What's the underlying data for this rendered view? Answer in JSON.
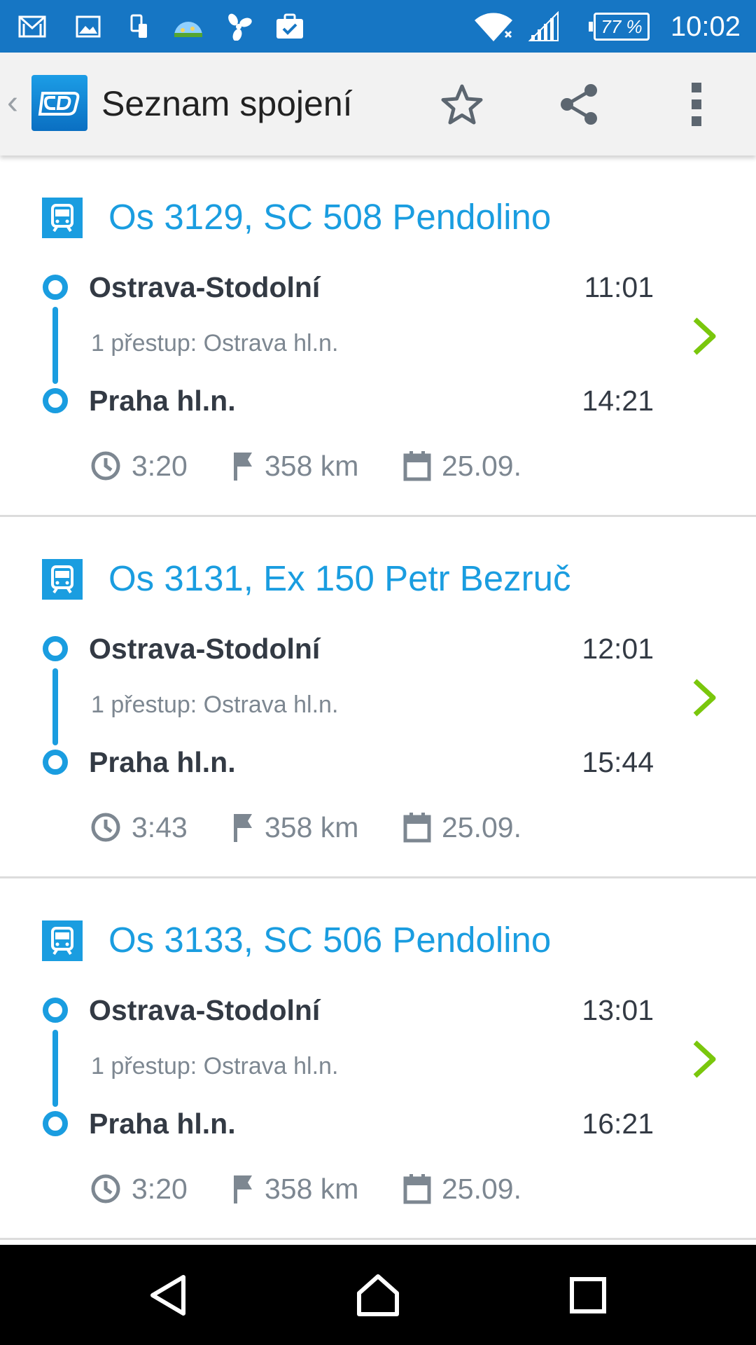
{
  "status_bar": {
    "time": "10:02",
    "battery": "77 %",
    "icons": [
      "gmail-icon",
      "gallery-icon",
      "phone-transfer-icon",
      "weather-icon",
      "fan-icon",
      "work-briefcase-icon",
      "wifi-icon",
      "cellular-signal-icon",
      "battery-icon"
    ]
  },
  "app_bar": {
    "title": "Seznam spojení",
    "logo": "cd-logo",
    "actions": [
      "star-icon",
      "share-icon",
      "overflow-menu-icon"
    ]
  },
  "colors": {
    "status_bar": "#1676c4",
    "accent": "#1a9de0",
    "chevron": "#7ac70c",
    "text_dark": "#333a44",
    "text_muted": "#7d8791"
  },
  "connections": [
    {
      "title": "Os 3129, SC 508 Pendolino",
      "from_station": "Ostrava-Stodolní",
      "from_time": "11:01",
      "transfer": "1 přestup: Ostrava hl.n.",
      "to_station": "Praha hl.n.",
      "to_time": "14:21",
      "duration": "3:20",
      "distance": "358 km",
      "date": "25.09."
    },
    {
      "title": "Os 3131, Ex 150 Petr Bezruč",
      "from_station": "Ostrava-Stodolní",
      "from_time": "12:01",
      "transfer": "1 přestup: Ostrava hl.n.",
      "to_station": "Praha hl.n.",
      "to_time": "15:44",
      "duration": "3:43",
      "distance": "358 km",
      "date": "25.09."
    },
    {
      "title": "Os 3133, SC 506 Pendolino",
      "from_station": "Ostrava-Stodolní",
      "from_time": "13:01",
      "transfer": "1 přestup: Ostrava hl.n.",
      "to_station": "Praha hl.n.",
      "to_time": "16:21",
      "duration": "3:20",
      "distance": "358 km",
      "date": "25.09."
    }
  ],
  "nav_bar": {
    "buttons": [
      "back-icon",
      "home-icon",
      "recents-icon"
    ]
  }
}
